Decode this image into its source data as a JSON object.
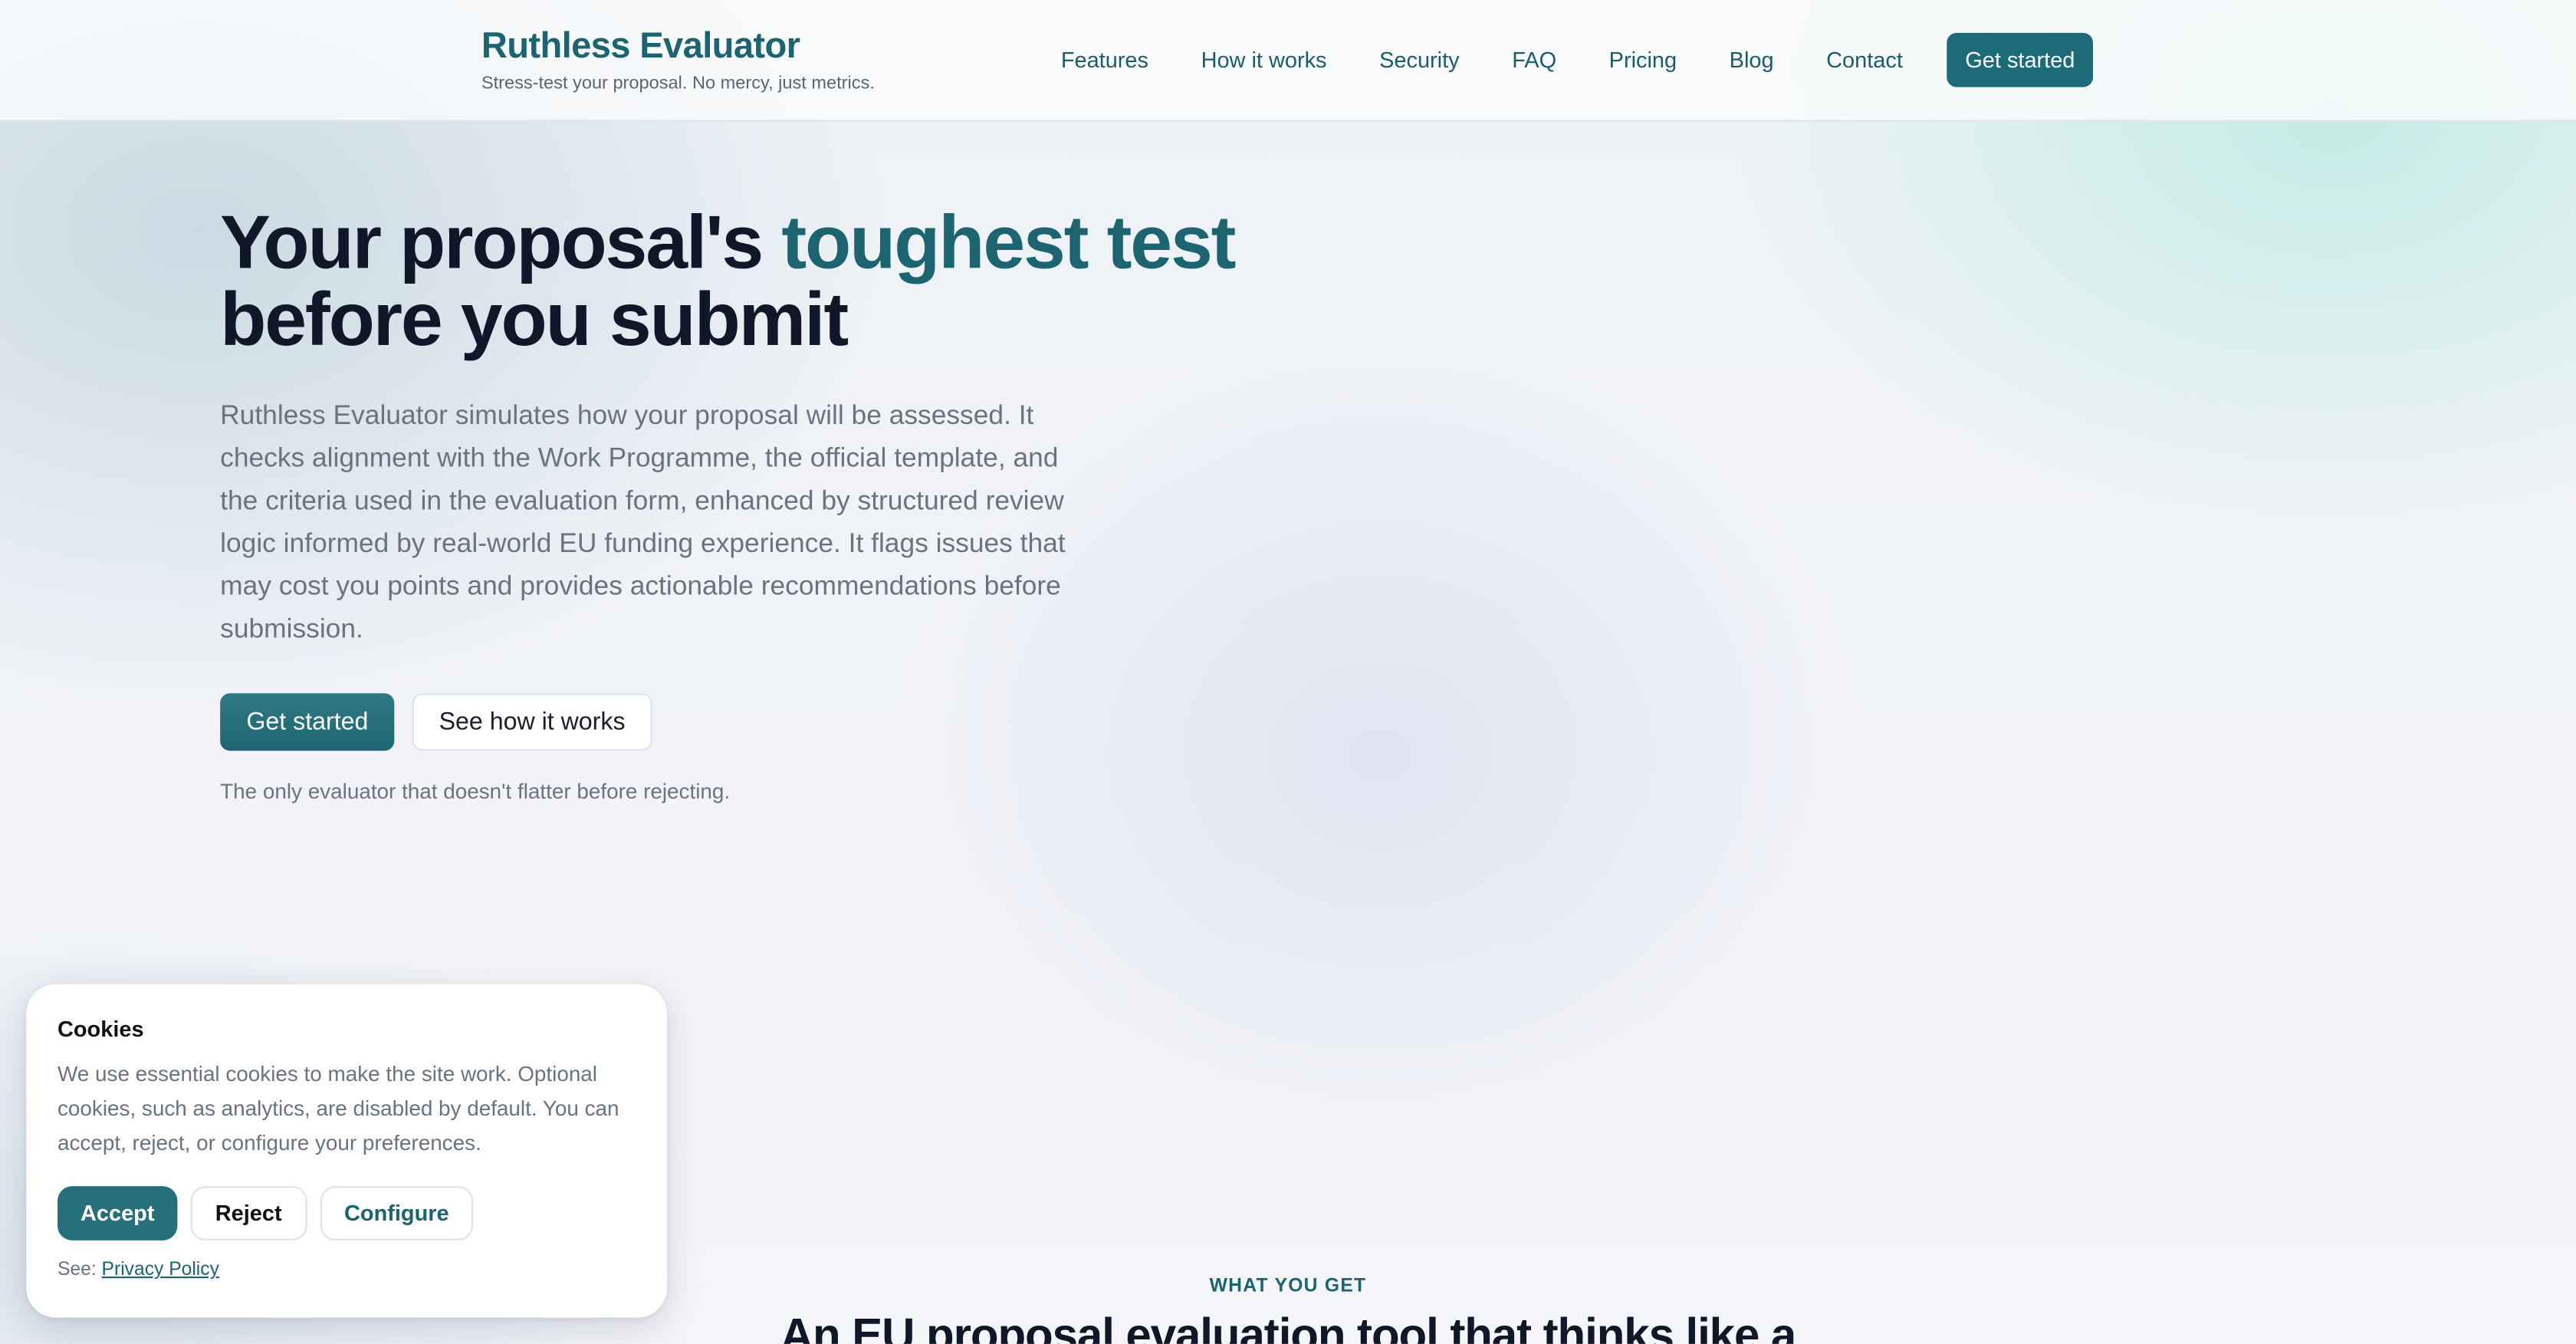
{
  "header": {
    "brand_title": "Ruthless Evaluator",
    "brand_tagline": "Stress-test your proposal. No mercy, just metrics.",
    "nav": [
      "Features",
      "How it works",
      "Security",
      "FAQ",
      "Pricing",
      "Blog",
      "Contact"
    ],
    "cta_label": "Get started"
  },
  "hero": {
    "title_part1": "Your proposal's ",
    "title_accent": "toughest test",
    "title_part2": "before you submit",
    "description": "Ruthless Evaluator simulates how your proposal will be assessed. It checks alignment with the Work Programme, the official template, and the criteria used in the evaluation form, enhanced by structured review logic informed by real-world EU funding experience. It flags issues that may cost you points and provides actionable recommendations before submission.",
    "primary_label": "Get started",
    "secondary_label": "See how it works",
    "note": "The only evaluator that doesn't flatter before rejecting."
  },
  "section": {
    "kicker": "WHAT YOU GET",
    "title": "An EU proposal evaluation tool that thinks like a"
  },
  "cookies": {
    "title": "Cookies",
    "text": "We use essential cookies to make the site work. Optional cookies, such as analytics, are disabled by default. You can accept, reject, or configure your preferences.",
    "accept_label": "Accept",
    "reject_label": "Reject",
    "configure_label": "Configure",
    "see_label": "See: ",
    "privacy_label": "Privacy Policy"
  },
  "colors": {
    "accent": "#1b6470",
    "primary_button": "#1d6b78",
    "heading": "#0f1729",
    "muted_text": "#6b7380"
  }
}
